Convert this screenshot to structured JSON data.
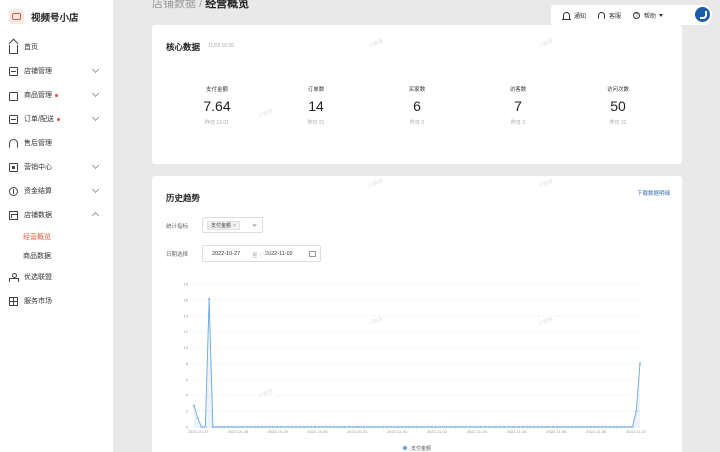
{
  "app": {
    "title": "视频号小店"
  },
  "breadcrumb": {
    "parent": "店铺数据",
    "separator": "/",
    "current": "经营概览"
  },
  "topbar": {
    "notify": "通知",
    "service": "客服",
    "help": "帮助"
  },
  "sidebar": {
    "items": [
      {
        "label": "首页"
      },
      {
        "label": "店铺管理"
      },
      {
        "label": "商品管理"
      },
      {
        "label": "订单/配送"
      },
      {
        "label": "售后管理"
      },
      {
        "label": "营销中心"
      },
      {
        "label": "资金结算"
      },
      {
        "label": "店铺数据"
      },
      {
        "label": "优选联盟"
      },
      {
        "label": "服务市场"
      }
    ],
    "sub_items": [
      {
        "label": "经营概览"
      },
      {
        "label": "商品数据"
      }
    ]
  },
  "core": {
    "title": "核心数据",
    "updated": "11/03 10:26",
    "metrics": [
      {
        "label": "支付金额",
        "value": "7.64",
        "prev": "昨日 12.01"
      },
      {
        "label": "订单数",
        "value": "14",
        "prev": "昨日 21"
      },
      {
        "label": "买家数",
        "value": "6",
        "prev": "昨日 3"
      },
      {
        "label": "访客数",
        "value": "7",
        "prev": "昨日 3"
      },
      {
        "label": "访问次数",
        "value": "50",
        "prev": "昨日 31"
      }
    ]
  },
  "history": {
    "title": "历史趋势",
    "download": "下载数据明细",
    "metric_label": "统计指标",
    "metric_tag": "支付金额",
    "date_label": "日期选择",
    "date_start": "2022-10-27",
    "date_to": "至",
    "date_end": "2022-11-02"
  },
  "chart_data": {
    "type": "line",
    "ylim": [
      0,
      18
    ],
    "yticks": [
      0,
      2,
      4,
      6,
      8,
      10,
      12,
      14,
      16,
      18
    ],
    "x_tick_labels": [
      "2022-10-27",
      "2022-10-28",
      "2022-10-29",
      "2022-10-30",
      "2022-10-31",
      "2022-11-01",
      "2022-11-02",
      "2022-11-03",
      "2022-11-04",
      "2022-11-05",
      "2022-11-06",
      "2022-11-07"
    ],
    "series": [
      {
        "name": "支付金额",
        "color": "#6ba7e0",
        "values": [
          2.7,
          1.1,
          0,
          0,
          16.1,
          0,
          0,
          0,
          0,
          0,
          0,
          0,
          0,
          0,
          0,
          0,
          0,
          0,
          0,
          0,
          0,
          0,
          0,
          0,
          0,
          0,
          0,
          0,
          0,
          0,
          0,
          0,
          0,
          0,
          0,
          0,
          0,
          0,
          0,
          0,
          0,
          0,
          0,
          0,
          0,
          0,
          0,
          0,
          0,
          0,
          0,
          0,
          0,
          0,
          0,
          0,
          0,
          0,
          0,
          0,
          0,
          0,
          0,
          0,
          0,
          0,
          0,
          0,
          0,
          0,
          0,
          0,
          0,
          0,
          0,
          0,
          0,
          0,
          0,
          0,
          0,
          0,
          0,
          0,
          0,
          0,
          0,
          0,
          0,
          0,
          0,
          0,
          0,
          0,
          0,
          0,
          0,
          0,
          0,
          0,
          0,
          0,
          0,
          0,
          0,
          0,
          0,
          0,
          0,
          0,
          0,
          0,
          0,
          0,
          0,
          0,
          0,
          2.0,
          8.0
        ]
      }
    ]
  }
}
